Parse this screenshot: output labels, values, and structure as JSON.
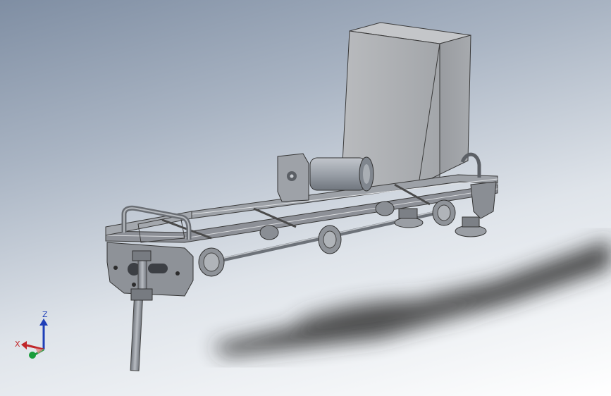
{
  "viewport": {
    "background_top": "#7f8ea3",
    "background_bottom": "#ffffff"
  },
  "triad": {
    "z_label": "Z",
    "x_label": "X",
    "z_color": "#1f3fb8",
    "x_color": "#c0262a",
    "y_color": "#1a9c3b"
  },
  "model": {
    "box_color": "#a9abae",
    "frame_color": "#8d9097",
    "motor_color": "#9aa0a8",
    "shadow_color": "#2a2a2a"
  }
}
